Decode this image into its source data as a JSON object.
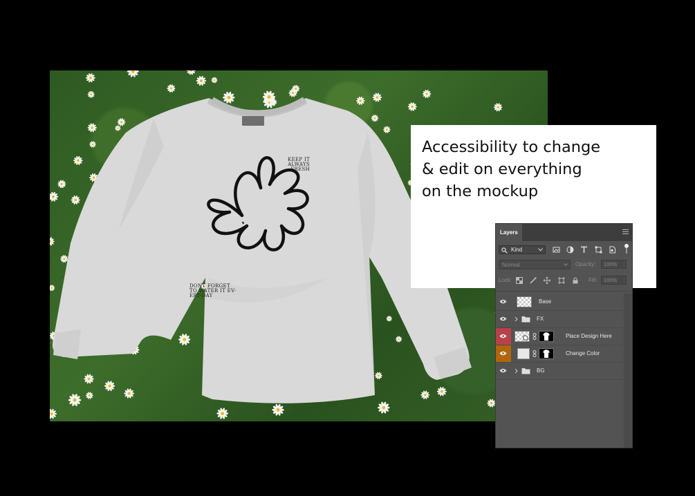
{
  "headline": "Accessibility to change\n& edit on everything\non the mockup",
  "shirt": {
    "top_text_line1": "KEEP IT",
    "top_text_line2": "ALWAYS FRESH",
    "bottom_text_line1": "DONT FORGET",
    "bottom_text_line2": "TO WATER IT EV-",
    "bottom_text_line3": "ERY-DAY"
  },
  "layers_panel": {
    "tab_label": "Layers",
    "filter_kind": "Kind",
    "blend_mode": "Normal",
    "opacity_label": "Opacity:",
    "opacity_value": "100%",
    "lock_label": "Lock:",
    "fill_label": "Fill:",
    "fill_value": "100%",
    "layers": [
      {
        "name": "Base",
        "type": "layer",
        "eye_color": "#535353"
      },
      {
        "name": "FX",
        "type": "group",
        "eye_color": "#535353"
      },
      {
        "name": "Place Design Here",
        "type": "smart-object",
        "eye_color": "#b8414a"
      },
      {
        "name": "Change Color",
        "type": "fill",
        "eye_color": "#b0660c"
      },
      {
        "name": "BG",
        "type": "group",
        "eye_color": "#535353"
      }
    ]
  },
  "colors": {
    "background": "#000000",
    "panel_bg": "#535353",
    "red_label": "#b8414a",
    "orange_label": "#b0660c"
  }
}
